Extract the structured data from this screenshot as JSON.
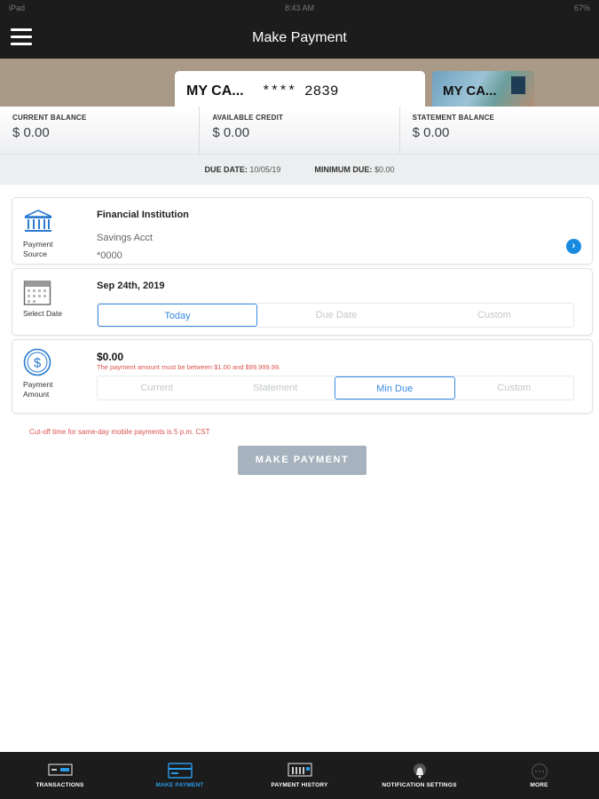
{
  "status_bar": {
    "left": "iPad",
    "time": "8:43 AM",
    "battery": "67%"
  },
  "nav": {
    "title": "Make Payment"
  },
  "cards": {
    "primary_name": "MY CA...",
    "primary_number": "**** 2839",
    "secondary_name": "MY CA..."
  },
  "balances": [
    {
      "label": "CURRENT BALANCE",
      "value": "$ 0.00"
    },
    {
      "label": "AVAILABLE CREDIT",
      "value": "$ 0.00"
    },
    {
      "label": "STATEMENT BALANCE",
      "value": "$ 0.00"
    }
  ],
  "due": {
    "due_date_label": "DUE DATE:",
    "due_date_value": "10/05/19",
    "min_due_label": "MINIMUM DUE:",
    "min_due_value": "$0.00"
  },
  "source": {
    "icon_label": "Payment Source",
    "title": "Financial Institution",
    "account": "Savings Acct",
    "number": "*0000"
  },
  "date": {
    "icon_label": "Select Date",
    "value": "Sep 24th, 2019",
    "options": [
      "Today",
      "Due Date",
      "Custom"
    ],
    "selected": "Today"
  },
  "amount": {
    "icon_label": "Payment Amount",
    "value": "$0.00",
    "error": "The payment amount must be between $1.00 and $99,999.99.",
    "options": [
      "Current",
      "Statement",
      "Min Due",
      "Custom"
    ],
    "selected": "Min Due"
  },
  "cutoff_note": "Cut-off time for same-day mobile payments is 5 p.m. CST",
  "make_payment_button": "MAKE PAYMENT",
  "tabs": [
    {
      "label": "TRANSACTIONS",
      "icon": "transactions-icon"
    },
    {
      "label": "MAKE PAYMENT",
      "icon": "card-icon"
    },
    {
      "label": "PAYMENT HISTORY",
      "icon": "history-icon"
    },
    {
      "label": "NOTIFICATION SETTINGS",
      "icon": "bell-icon"
    },
    {
      "label": "MORE",
      "icon": "more-icon"
    }
  ],
  "colors": {
    "accent": "#3b8ae0",
    "error": "#d9534f",
    "bar": "#1c1c1c",
    "active_tab": "#2a9be8"
  }
}
